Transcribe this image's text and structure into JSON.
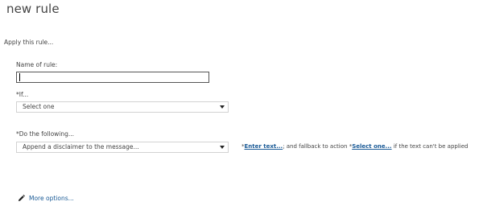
{
  "title": "new rule",
  "intro": "Apply this rule...",
  "name_field": {
    "label": "Name of rule:",
    "value": ""
  },
  "condition": {
    "label": "*If...",
    "value": "Select one"
  },
  "action": {
    "label": "*Do the following...",
    "value": "Append a disclaimer to the message...",
    "required_marker": "*",
    "enter_text_link": "Enter text...",
    "middle_text": "; and fallback to action ",
    "required_marker_2": "*",
    "select_one_link": "Select one...",
    "trailing_text": " if the text can't be applied"
  },
  "more_options": {
    "label": "More options...",
    "icon": "pencil-icon"
  },
  "colors": {
    "link": "#1a5a96",
    "text": "#444444",
    "input_border": "#555555",
    "select_border": "#d2d2d2"
  }
}
